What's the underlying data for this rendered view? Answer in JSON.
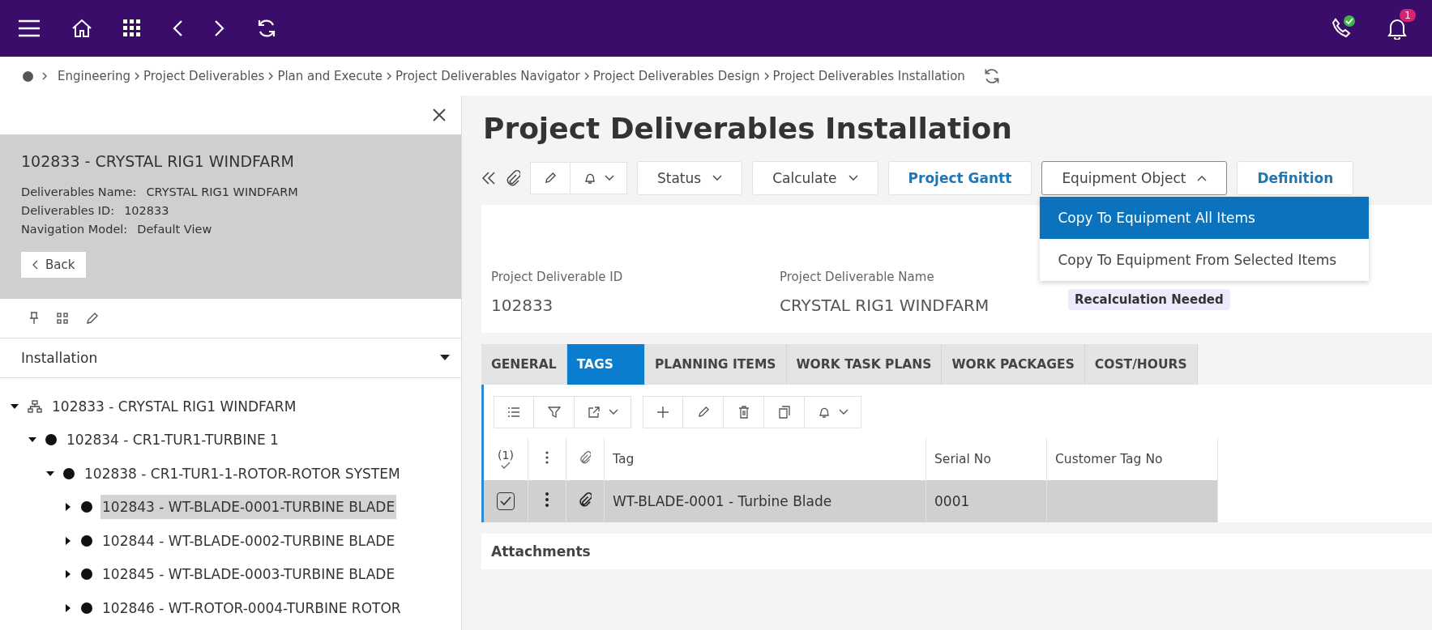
{
  "notifications": {
    "count": "1"
  },
  "breadcrumb": [
    "Engineering",
    "Project Deliverables",
    "Plan and Execute",
    "Project Deliverables Navigator",
    "Project Deliverables Design",
    "Project Deliverables Installation"
  ],
  "side_panel": {
    "title": "102833 - CRYSTAL RIG1 WINDFARM",
    "fields": [
      {
        "label": "Deliverables Name:",
        "value": "CRYSTAL RIG1 WINDFARM"
      },
      {
        "label": "Deliverables ID:",
        "value": "102833"
      },
      {
        "label": "Navigation Model:",
        "value": "Default View"
      }
    ],
    "back_button": "Back",
    "view_select": "Installation",
    "tree": [
      {
        "label": "102833 - CRYSTAL RIG1 WINDFARM",
        "kind": "structure",
        "expanded": true,
        "selected": false,
        "children": [
          {
            "label": "102834 - CR1-TUR1-TURBINE 1",
            "kind": "item",
            "expanded": true,
            "selected": false,
            "children": [
              {
                "label": "102838 - CR1-TUR1-1-ROTOR-ROTOR SYSTEM",
                "kind": "item",
                "expanded": true,
                "selected": false,
                "children": [
                  {
                    "label": "102843 - WT-BLADE-0001-TURBINE BLADE",
                    "kind": "item",
                    "expanded": false,
                    "selected": true
                  },
                  {
                    "label": "102844 - WT-BLADE-0002-TURBINE BLADE",
                    "kind": "item",
                    "expanded": false,
                    "selected": false
                  },
                  {
                    "label": "102845 - WT-BLADE-0003-TURBINE BLADE",
                    "kind": "item",
                    "expanded": false,
                    "selected": false
                  },
                  {
                    "label": "102846 - WT-ROTOR-0004-TURBINE ROTOR",
                    "kind": "item",
                    "expanded": false,
                    "selected": false
                  }
                ]
              }
            ]
          }
        ]
      }
    ]
  },
  "page_title": "Project Deliverables Installation",
  "toolbar": [
    {
      "label": "Status",
      "kind": "dropdown",
      "expanded": false
    },
    {
      "label": "Calculate",
      "kind": "dropdown",
      "expanded": false
    },
    {
      "label": "Project Gantt",
      "kind": "link"
    },
    {
      "label": "Equipment Object",
      "kind": "dropdown",
      "expanded": true
    },
    {
      "label": "Definition",
      "kind": "link"
    }
  ],
  "dropdown_menu": [
    {
      "label": "Copy To Equipment All Items",
      "selected": true
    },
    {
      "label": "Copy To Equipment From Selected Items",
      "selected": false
    }
  ],
  "header_card": {
    "fields": [
      {
        "label": "Project Deliverable ID",
        "value": "102833"
      },
      {
        "label": "Project Deliverable Name",
        "value": "CRYSTAL RIG1 WINDFARM"
      }
    ],
    "badge": "Recalculation Needed"
  },
  "tabs": [
    {
      "label": "GENERAL",
      "selected": false
    },
    {
      "label": "TAGS",
      "selected": true
    },
    {
      "label": "PLANNING ITEMS",
      "selected": false
    },
    {
      "label": "WORK TASK PLANS",
      "selected": false
    },
    {
      "label": "WORK PACKAGES",
      "selected": false
    },
    {
      "label": "COST/HOURS",
      "selected": false
    }
  ],
  "table": {
    "selected_count": "(1)",
    "columns": [
      "Tag",
      "Serial No",
      "Customer Tag No"
    ],
    "rows": [
      {
        "checked": true,
        "selected": true,
        "cells": [
          "WT-BLADE-0001 - Turbine Blade",
          "0001",
          ""
        ]
      }
    ]
  },
  "attachments": {
    "title": "Attachments"
  }
}
